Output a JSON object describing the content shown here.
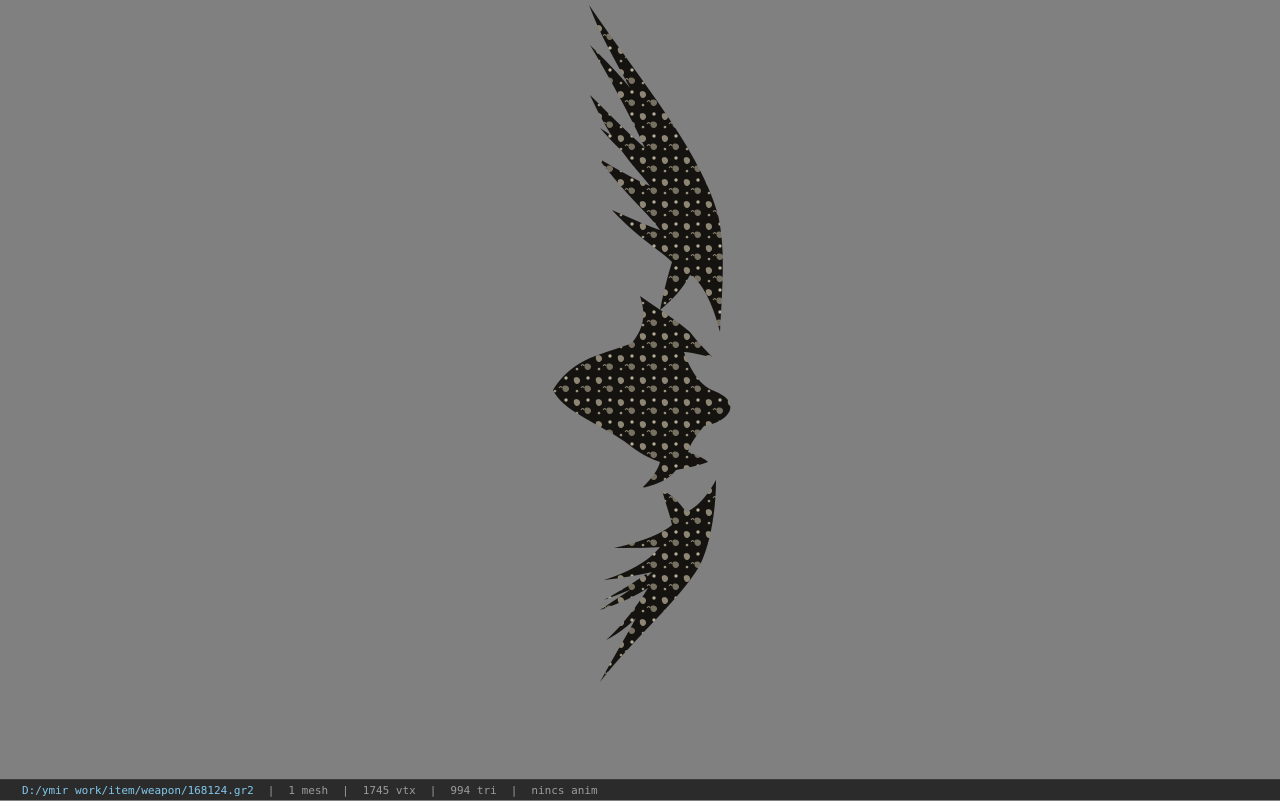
{
  "viewport": {
    "background_color": "#808080",
    "model": {
      "icon": "bow-model",
      "body_color": "#151310",
      "pattern_color": "#a39a86"
    }
  },
  "statusbar": {
    "path": "D:/ymir work/item/weapon/168124.gr2",
    "separator": "|",
    "mesh": "1 mesh",
    "vertices": "1745 vtx",
    "triangles": "994 tri",
    "anim": "nincs anim"
  }
}
